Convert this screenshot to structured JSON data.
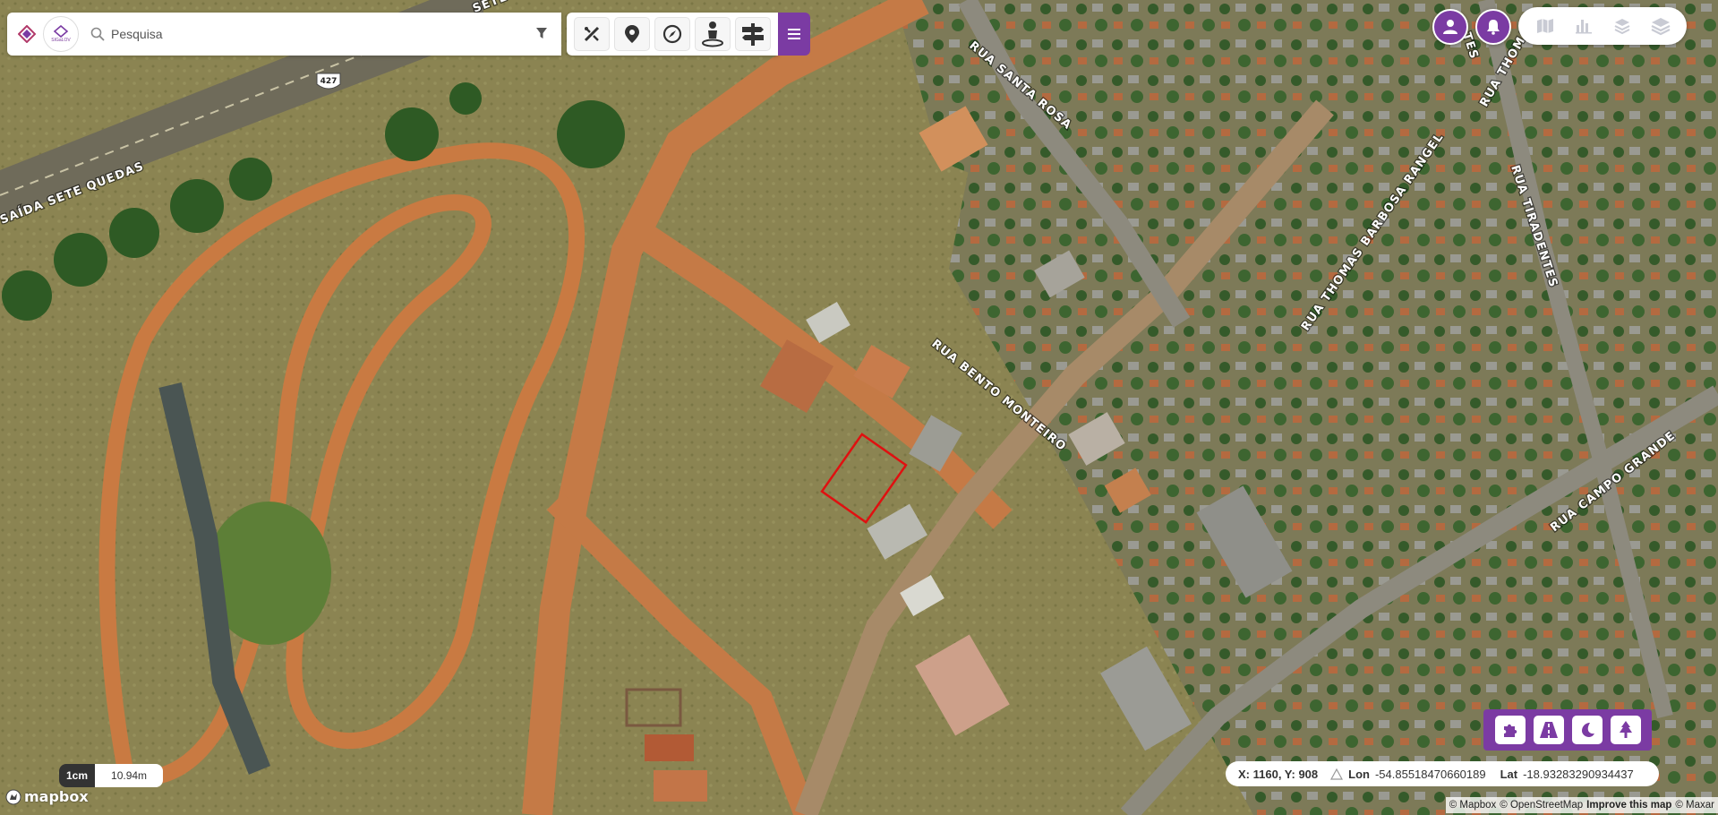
{
  "search": {
    "placeholder": "Pesquisa",
    "logo_text": "SIGaLOV"
  },
  "toolbar": {
    "tools": [
      {
        "id": "measure",
        "icon": "measure-ruler-icon"
      },
      {
        "id": "pin",
        "icon": "map-pin-icon"
      },
      {
        "id": "compass",
        "icon": "compass-icon"
      },
      {
        "id": "street-view",
        "icon": "person-pin-icon"
      },
      {
        "id": "signs",
        "icon": "signpost-icon"
      }
    ],
    "menu_icon": "hamburger-menu-icon"
  },
  "top_right": {
    "user_icon": "user-icon",
    "notifications_icon": "bell-icon",
    "layers": [
      "map-icon",
      "bar-chart-icon",
      "stack-layers-icon",
      "layers-icon"
    ]
  },
  "bottom_tools": [
    "puzzle-piece-icon",
    "road-icon",
    "moon-icon",
    "tree-icon"
  ],
  "coordinates": {
    "x_label": "X: 1160, Y: 908",
    "lon_label": "Lon",
    "lon_value": "-54.85518470660189",
    "lat_label": "Lat",
    "lat_value": "-18.93283290934437"
  },
  "scale": {
    "unit": "1cm",
    "value": "10.94m"
  },
  "mapbox_logo": "mapbox",
  "attribution": {
    "mapbox": "© Mapbox",
    "osm": "© OpenStreetMap",
    "improve": "Improve this map",
    "maxar": "© Maxar"
  },
  "map_labels": {
    "road_427": "427",
    "saida": "SAÍDA SETE QUEDAS",
    "sete": "SETE",
    "santa_rosa": "RUA SANTA ROSA",
    "bento": "RUA BENTO MONTEIRO",
    "thomas_barbosa": "RUA THOMAS BARBOSA RANGEL",
    "tiradentes": "RUA TIRADENTES",
    "tiradentes_top": "TES",
    "thomas_top": "RUA THOMA",
    "campo_grande": "RUA CAMPO GRANDE"
  },
  "colors": {
    "accent": "#7b3ba3",
    "parcel_outline": "#e01010"
  }
}
